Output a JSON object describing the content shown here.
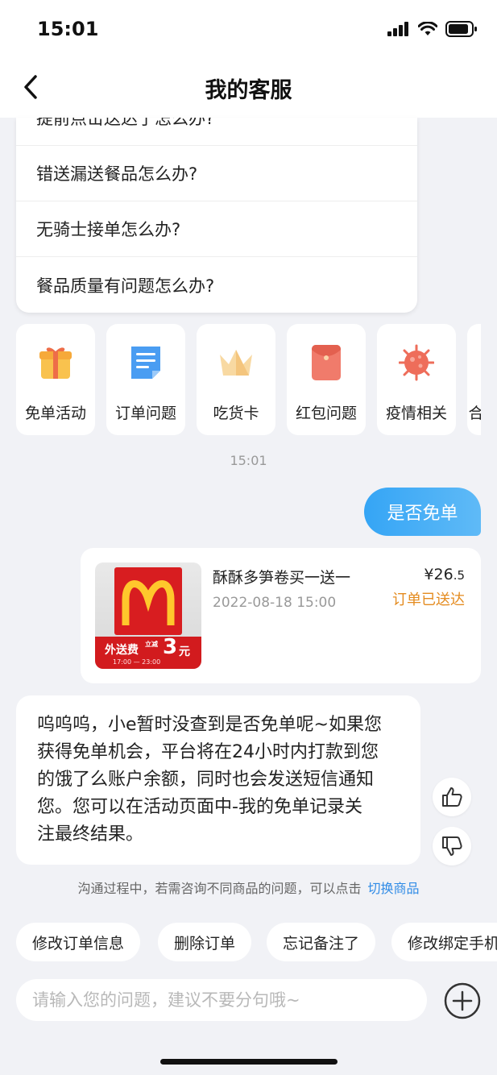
{
  "status_bar": {
    "time": "15:01"
  },
  "nav": {
    "title": "我的客服"
  },
  "faq": {
    "items": [
      "提前点击送达了怎么办?",
      "错送漏送餐品怎么办?",
      "无骑士接单怎么办?",
      "餐品质量有问题怎么办?"
    ]
  },
  "categories": [
    {
      "label": "免单活动",
      "icon": "gift-icon"
    },
    {
      "label": "订单问题",
      "icon": "document-icon"
    },
    {
      "label": "吃货卡",
      "icon": "crown-icon"
    },
    {
      "label": "红包问题",
      "icon": "red-envelope-icon"
    },
    {
      "label": "疫情相关",
      "icon": "virus-icon"
    },
    {
      "label": "合",
      "icon": "more-icon"
    }
  ],
  "chat": {
    "timestamp": "15:01",
    "user_message": "是否免单",
    "order": {
      "name": "酥酥多笋卷买一送一",
      "date": "2022-08-18 15:00",
      "price_symbol": "¥",
      "price_int": "26",
      "price_dec": ".5",
      "status": "订单已送达",
      "thumb_banner_text": "外送费",
      "thumb_banner_small": "立减",
      "thumb_banner_num": "3",
      "thumb_banner_unit": "元",
      "thumb_banner_hours": "17:00 — 23:00"
    },
    "bot_lines": [
      "呜呜呜，小e暂时没查到是否免单呢~如果您",
      "获得免单机会，平台将在24小时内打款到您",
      "的饿了么账户余额，同时也会发送短信通知",
      "您。您可以在活动页面中-我的免单记录关",
      "注最终结果。"
    ]
  },
  "switch_hint": {
    "text": "沟通过程中，若需咨询不同商品的问题，可以点击",
    "link": "切换商品"
  },
  "quick_replies": [
    "修改订单信息",
    "删除订单",
    "忘记备注了",
    "修改绑定手机"
  ],
  "input": {
    "placeholder": "请输入您的问题，建议不要分句哦~"
  },
  "colors": {
    "accent_blue": "#35a5f5",
    "status_orange": "#e48b1f",
    "brand_red": "#d81d20",
    "background": "#f1f2f6"
  }
}
